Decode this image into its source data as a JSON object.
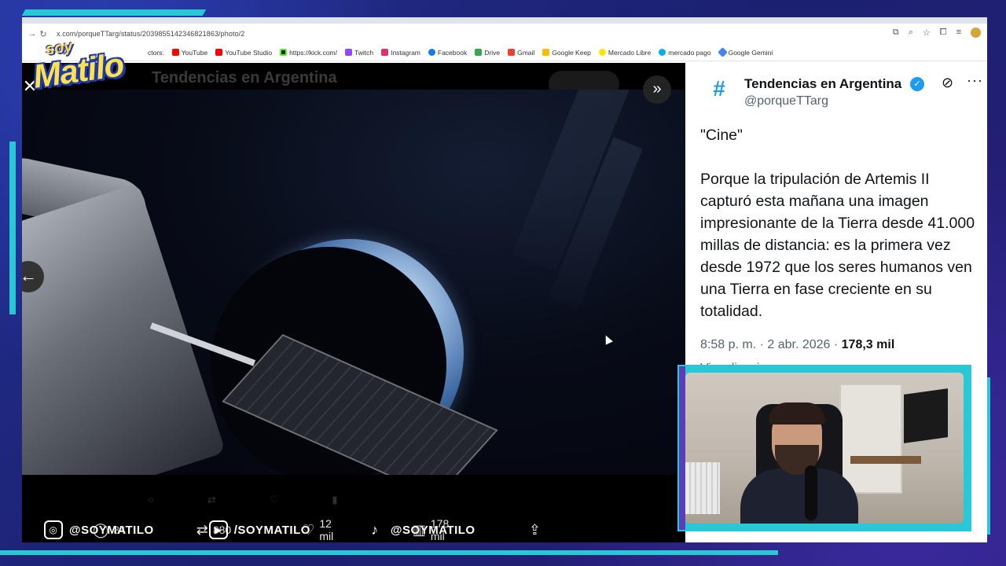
{
  "browser": {
    "url": "x.com/porqueTTarg/status/2039855142346821863/photo/2",
    "bookmarks": [
      {
        "label": "ctors:",
        "color": "#ffffff"
      },
      {
        "label": "YouTube",
        "color": "#ff0000"
      },
      {
        "label": "YouTube Studio",
        "color": "#ff0000"
      },
      {
        "label": "https://kick.com/",
        "color": "#53fc18"
      },
      {
        "label": "Twitch",
        "color": "#9146ff"
      },
      {
        "label": "Instagram",
        "color": "#e1306c"
      },
      {
        "label": "Facebook",
        "color": "#1877f2"
      },
      {
        "label": "Drive",
        "color": "#34a853"
      },
      {
        "label": "Gmail",
        "color": "#ea4335"
      },
      {
        "label": "Google Keep",
        "color": "#fbbc04"
      },
      {
        "label": "Mercado Libre",
        "color": "#ffe600"
      },
      {
        "label": "mercado pago",
        "color": "#00b1ea"
      },
      {
        "label": "Google Gemini",
        "color": "#4285f4"
      }
    ]
  },
  "viewer": {
    "ghost_title": "Tendencias en Argentina",
    "actions": {
      "replies": "84",
      "reposts": "880",
      "likes": "12 mil",
      "views": "178 mil"
    }
  },
  "tweet": {
    "author_name": "Tendencias en Argentina",
    "handle": "@porqueTTarg",
    "avatar_symbol": "#",
    "paragraph1": "\"Cine\"",
    "paragraph2": "Porque la tripulación de Artemis II capturó esta mañana una imagen impresionante de la Tierra desde 41.000 millas de distancia: es la primera vez desde 1972 que los seres humanos ven una Tierra en fase creciente en su totalidad.",
    "time": "8:58 p. m. · 2 abr. 2026 · ",
    "views_count": "178,3 mil",
    "views_label": "Visualizaciones"
  },
  "overlay": {
    "logo_small": "soy",
    "logo_big": "Matilo",
    "socials": [
      {
        "handle": "@SOYMATILO",
        "icon": "instagram-icon"
      },
      {
        "handle": "/SOYMATILO",
        "icon": "youtube-icon"
      },
      {
        "handle": "@SOYMATILO",
        "icon": "tiktok-icon"
      }
    ]
  },
  "colors": {
    "accent_teal": "#28c8d6",
    "twitter_blue": "#1d9bf0",
    "logo_yellow": "#ffe14d"
  }
}
